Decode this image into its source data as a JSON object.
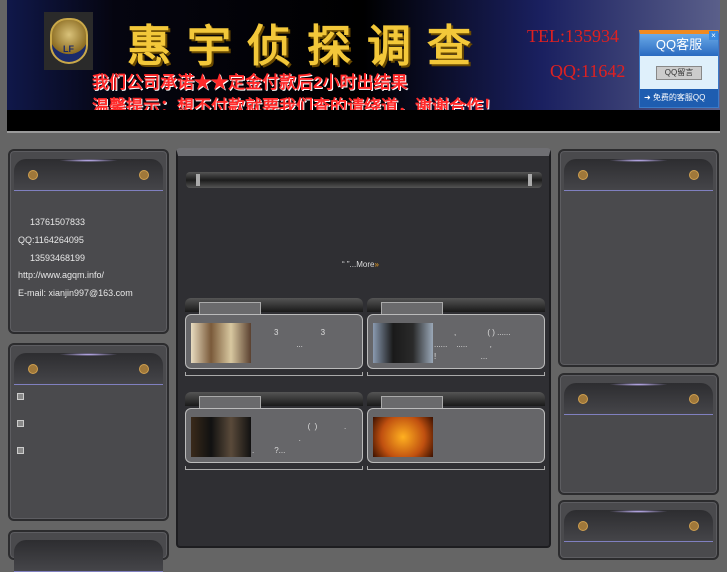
{
  "header": {
    "logo_text": "LF",
    "title": "惠宇侦探调查",
    "tel": "TEL:135934",
    "qq": "QQ:11642",
    "slogan1": "我们公司承诺★★定金付款后2小时出结果",
    "slogan2": "温馨提示：想不付款就要我们查的请绕道，谢谢合作！"
  },
  "qq_widget": {
    "title": "QQ客服",
    "button": "QQ留言",
    "footer": "免费的客服QQ",
    "close": "×"
  },
  "contact": {
    "lines": [
      "13761507833",
      "QQ:1164264095",
      "13593468199",
      "http://www.agqm.info/",
      "E-mail: xianjin997@163.com"
    ]
  },
  "center": {
    "more_prefix": "“  ”...",
    "more_label": "More"
  },
  "cards": [
    {
      "text": "3                   3\n          ..."
    },
    {
      "text": "         ,              ( ) ......\n......    .....          ,\n!                    ..."
    },
    {
      "text": "                         (  )            .\n                     .\n.         ?..."
    },
    {
      "text": ""
    }
  ]
}
